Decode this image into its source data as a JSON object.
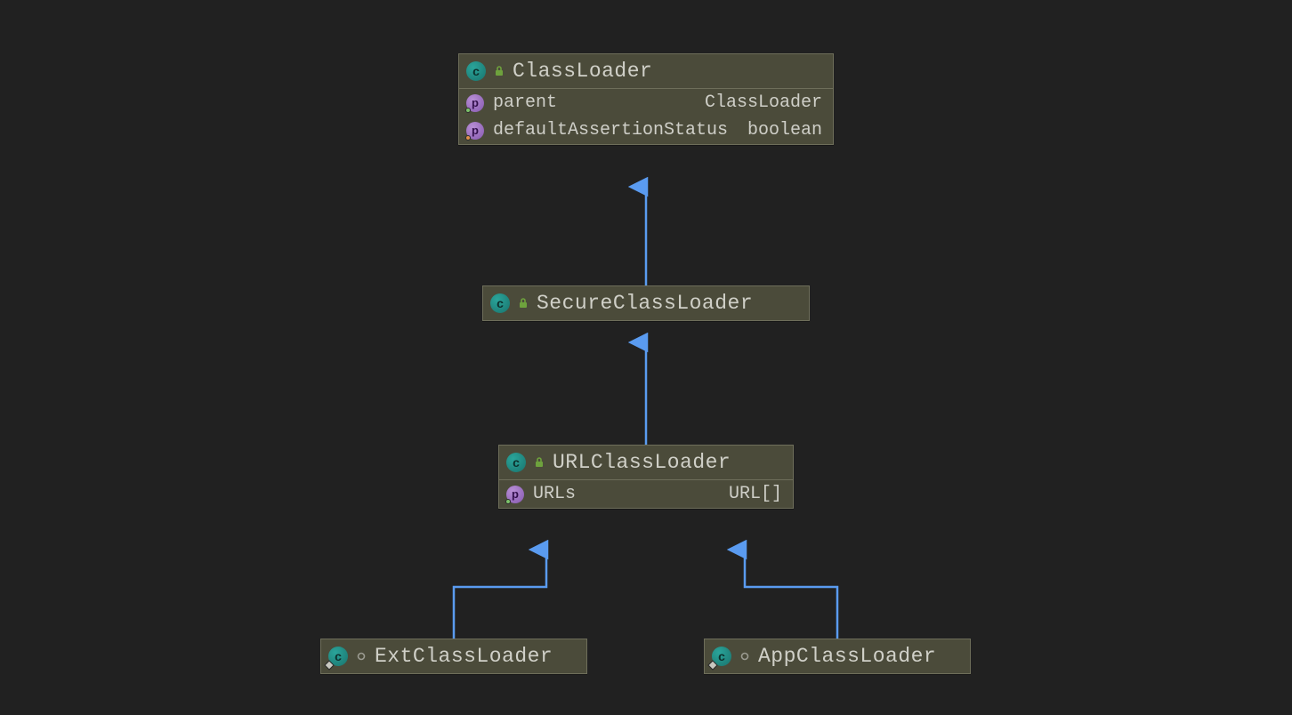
{
  "diagram": {
    "kind": "uml-class-hierarchy",
    "colors": {
      "background": "#212121",
      "node_fill": "#4b4b3a",
      "node_border": "#6e6e5a",
      "arrow": "#5a9bf0",
      "text": "#cfcfc8",
      "class_icon": "#1c7b74",
      "property_icon": "#8b5eb3",
      "abstract_marker": "#6ea23d"
    },
    "nodes": {
      "classloader": {
        "name": "ClassLoader",
        "icon": "class",
        "visibility": "abstract-locked",
        "fields": [
          {
            "name": "parent",
            "type": "ClassLoader",
            "icon": "property",
            "marker": "green"
          },
          {
            "name": "defaultAssertionStatus",
            "type": "boolean",
            "icon": "property",
            "marker": "orange"
          }
        ]
      },
      "secureclassloader": {
        "name": "SecureClassLoader",
        "icon": "class",
        "visibility": "abstract-locked",
        "fields": []
      },
      "urlclassloader": {
        "name": "URLClassLoader",
        "icon": "class",
        "visibility": "abstract-locked",
        "fields": [
          {
            "name": "URLs",
            "type": "URL[]",
            "icon": "property",
            "marker": "green"
          }
        ]
      },
      "extclassloader": {
        "name": "ExtClassLoader",
        "icon": "class",
        "visibility": "inner-public",
        "fields": []
      },
      "appclassloader": {
        "name": "AppClassLoader",
        "icon": "class",
        "visibility": "inner-public",
        "fields": []
      }
    },
    "edges": [
      {
        "from": "secureclassloader",
        "to": "classloader",
        "kind": "extends"
      },
      {
        "from": "urlclassloader",
        "to": "secureclassloader",
        "kind": "extends"
      },
      {
        "from": "extclassloader",
        "to": "urlclassloader",
        "kind": "extends"
      },
      {
        "from": "appclassloader",
        "to": "urlclassloader",
        "kind": "extends"
      }
    ]
  }
}
